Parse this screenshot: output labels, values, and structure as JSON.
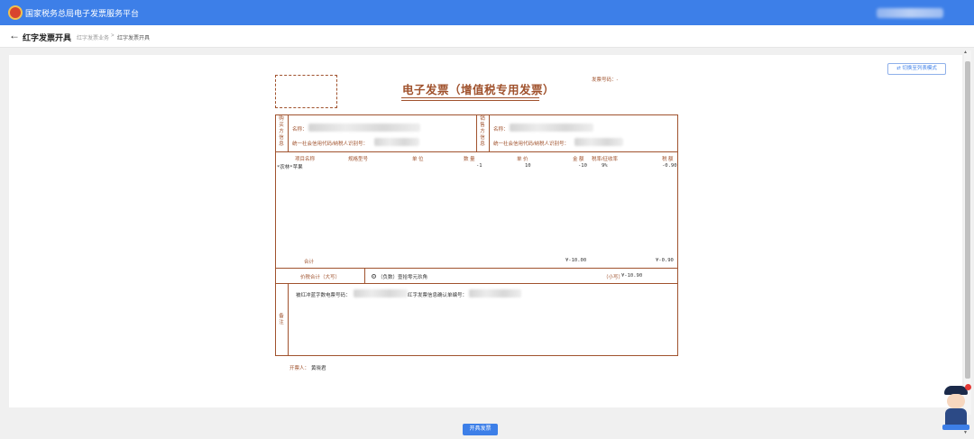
{
  "app": {
    "title": "国家税务总局电子发票服务平台"
  },
  "subheader": {
    "page_title": "红字发票开具",
    "breadcrumb": [
      "红字发票业务",
      ">",
      "红字发票开具"
    ]
  },
  "toolbar": {
    "switch_label": "切换至列表模式"
  },
  "invoice": {
    "title": "电子发票（增值税专用发票）",
    "number_label": "发票号码：",
    "number_value": "-",
    "buyer": {
      "side_label": "购买方信息",
      "name_label": "名称：",
      "tax_id_label": "统一社会信用代码/纳税人识别号："
    },
    "seller": {
      "side_label": "销售方信息",
      "name_label": "名称：",
      "tax_id_label": "统一社会信用代码/纳税人识别号："
    },
    "columns": [
      "项目名称",
      "规格型号",
      "单 位",
      "数 量",
      "单 价",
      "金 额",
      "税率/征收率",
      "税 额"
    ],
    "items": [
      {
        "name": "*农林*苹果",
        "spec": "",
        "unit": "",
        "qty": "-1",
        "price": "10",
        "amount": "-10",
        "rate": "9%",
        "tax": "-0.90"
      }
    ],
    "total_label": "合计",
    "total_amount": "¥-10.00",
    "total_tax": "¥-0.90",
    "grand_total_label": "价税合计（大写）",
    "grand_total_words": "（负数）壹拾零元玖角",
    "grand_total_small_label": "（小写）",
    "grand_total_small_value": "¥-10.90",
    "remarks_label": "备注",
    "remark_original_no_label": "被红冲蓝字数电票号码：",
    "remark_confirm_no_label": "红字发票信息确认单编号：",
    "issuer_label": "开票人：",
    "issuer_name": "黄晓君"
  },
  "actions": {
    "issue_label": "开具发票"
  },
  "colors": {
    "topbar": "#3d7fe8",
    "invoice_brown": "#a0522d",
    "button_blue": "#3d7fe8"
  }
}
